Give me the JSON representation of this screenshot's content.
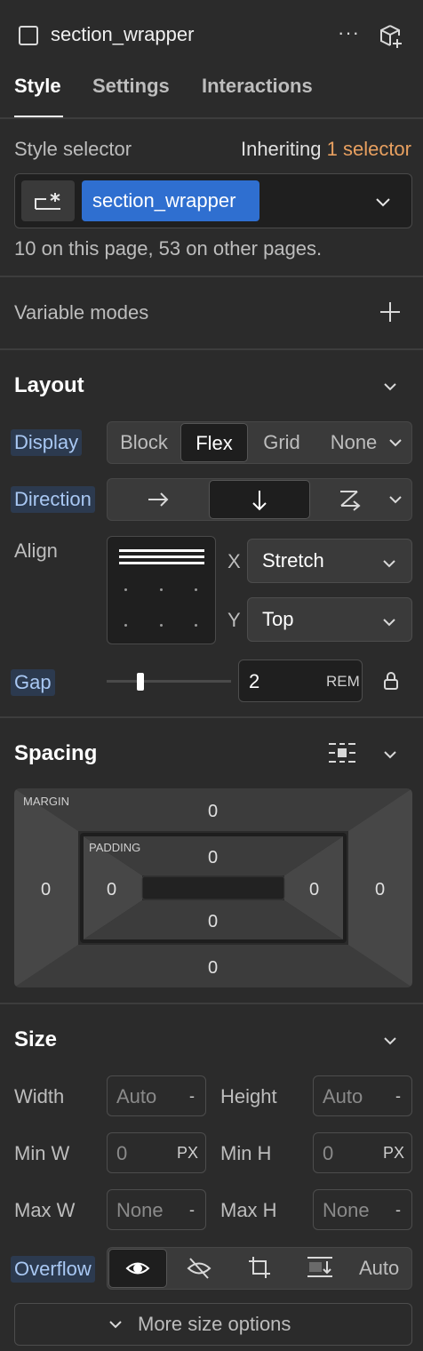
{
  "header": {
    "title": "section_wrapper",
    "more_label": "···"
  },
  "tabs": [
    {
      "label": "Style",
      "active": true
    },
    {
      "label": "Settings",
      "active": false
    },
    {
      "label": "Interactions",
      "active": false
    }
  ],
  "style_selector": {
    "label": "Style selector",
    "inheriting_prefix": "Inheriting",
    "inheriting_count": "1 selector",
    "tag": "section_wrapper",
    "usage": "10 on this page, 53 on other pages.",
    "tag_color": "#2f6fd0",
    "accent_color": "#e8a060"
  },
  "variable_modes": {
    "label": "Variable modes"
  },
  "layout": {
    "title": "Layout",
    "display": {
      "label": "Display",
      "options": [
        "Block",
        "Flex",
        "Grid",
        "None"
      ],
      "selected": "Flex"
    },
    "direction": {
      "label": "Direction",
      "options": [
        "arrow-right-icon",
        "arrow-down-icon",
        "wrap-icon"
      ],
      "selected": "arrow-down-icon"
    },
    "align": {
      "label": "Align",
      "x_label": "X",
      "x_value": "Stretch",
      "y_label": "Y",
      "y_value": "Top"
    },
    "gap": {
      "label": "Gap",
      "value": "2",
      "unit": "REM"
    }
  },
  "spacing": {
    "title": "Spacing",
    "margin_label": "MARGIN",
    "padding_label": "PADDING",
    "margin": {
      "top": "0",
      "right": "0",
      "bottom": "0",
      "left": "0"
    },
    "padding": {
      "top": "0",
      "right": "0",
      "bottom": "0",
      "left": "0"
    }
  },
  "size": {
    "title": "Size",
    "width": {
      "label": "Width",
      "value": "Auto",
      "unit": "-"
    },
    "height": {
      "label": "Height",
      "value": "Auto",
      "unit": "-"
    },
    "min_w": {
      "label": "Min W",
      "value": "0",
      "unit": "PX"
    },
    "min_h": {
      "label": "Min H",
      "value": "0",
      "unit": "PX"
    },
    "max_w": {
      "label": "Max W",
      "value": "None",
      "unit": "-"
    },
    "max_h": {
      "label": "Max H",
      "value": "None",
      "unit": "-"
    },
    "overflow": {
      "label": "Overflow",
      "options": [
        "eye-icon",
        "eye-off-icon",
        "crop-icon",
        "scroll-icon"
      ],
      "auto_label": "Auto",
      "selected": "eye-icon"
    },
    "more_options": "More size options"
  }
}
